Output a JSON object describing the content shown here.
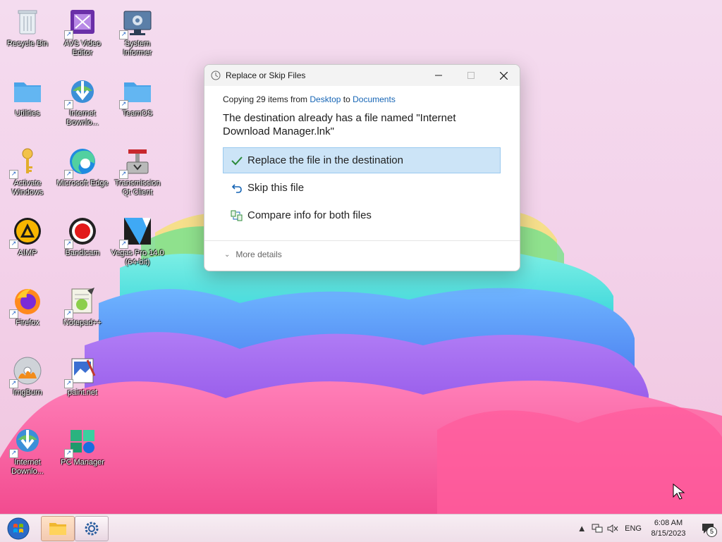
{
  "desktop": {
    "icons": [
      {
        "label": "Recycle Bin"
      },
      {
        "label": "AVS Video Editor"
      },
      {
        "label": "System Informer"
      },
      {
        "label": "Utilities"
      },
      {
        "label": "Internet Downlo..."
      },
      {
        "label": "TeamOS"
      },
      {
        "label": "Activate Windows"
      },
      {
        "label": "Microsoft Edge"
      },
      {
        "label": "Transmission Qt Client"
      },
      {
        "label": "AIMP"
      },
      {
        "label": "Bandicam"
      },
      {
        "label": "Vegas Pro 14.0 (64-bit)"
      },
      {
        "label": "Firefox"
      },
      {
        "label": "Notepad++"
      },
      {
        "label": "ImgBurn"
      },
      {
        "label": "paint.net"
      },
      {
        "label": "Internet Downlo..."
      },
      {
        "label": "PC Manager"
      }
    ]
  },
  "dialog": {
    "title": "Replace or Skip Files",
    "copy_prefix": "Copying 29 items from",
    "source": "Desktop",
    "copy_to": "to",
    "destination": "Documents",
    "headline": "The destination already has a file named \"Internet Download Manager.lnk\"",
    "options": [
      {
        "label": "Replace the file in the destination",
        "icon": "checkmark-icon",
        "selected": true
      },
      {
        "label": "Skip this file",
        "icon": "undo-arrow-icon"
      },
      {
        "label": "Compare info for both files",
        "icon": "compare-icon"
      }
    ],
    "more_details": "More details"
  },
  "taskbar": {
    "language": "ENG",
    "time": "6:08 AM",
    "date": "8/15/2023",
    "notification_count": "5"
  },
  "colors": {
    "accent_link": "#1665b5",
    "selected_bg": "#cce4f7"
  }
}
